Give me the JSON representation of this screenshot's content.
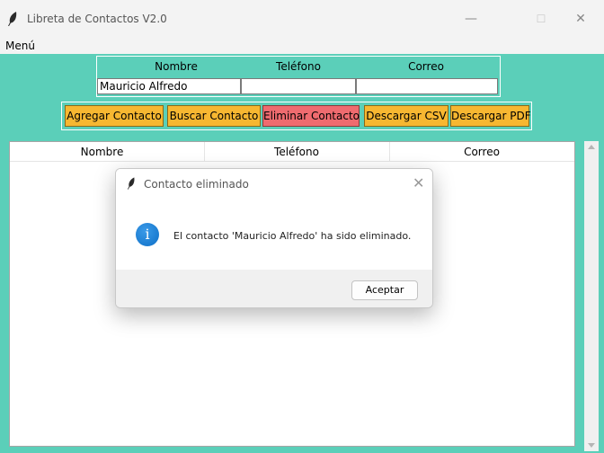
{
  "window": {
    "title": "Libreta de Contactos V2.0",
    "icon": "feather-icon",
    "controls": {
      "minimize": "—",
      "maximize": "☐",
      "close": "✕"
    }
  },
  "menu": {
    "items": [
      "Menú"
    ]
  },
  "form": {
    "headers": [
      "Nombre",
      "Teléfono",
      "Correo"
    ],
    "values": {
      "nombre": "Mauricio Alfredo",
      "telefono": "",
      "correo": ""
    }
  },
  "buttons": {
    "agregar": "Agregar Contacto",
    "buscar": "Buscar Contacto",
    "eliminar": "Eliminar Contacto",
    "csv": "Descargar CSV",
    "pdf": "Descargar PDF"
  },
  "table": {
    "columns": [
      "Nombre",
      "Teléfono",
      "Correo"
    ],
    "rows": []
  },
  "dialog": {
    "title": "Contacto eliminado",
    "message": "El contacto 'Mauricio Alfredo' ha sido eliminado.",
    "ok_label": "Aceptar",
    "icon": "info-icon",
    "close": "✕"
  },
  "colors": {
    "background": "#5bcfb9",
    "button": "#f7b731",
    "danger_button": "#ef6b6f",
    "info_icon": "#1a7fd8"
  }
}
